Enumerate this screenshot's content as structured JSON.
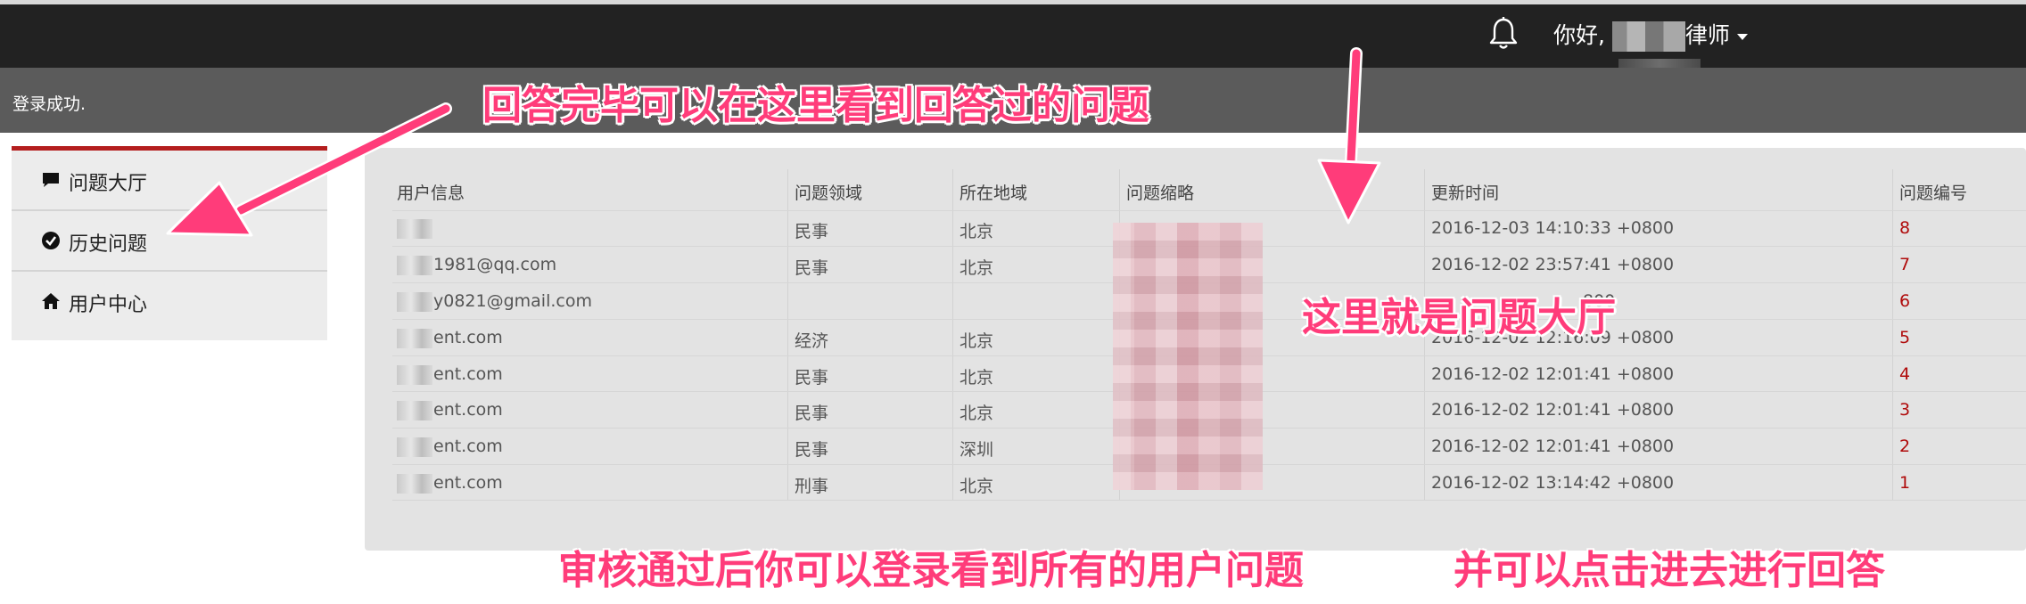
{
  "header": {
    "greeting_prefix": "你好,",
    "greeting_suffix": "律师"
  },
  "flash": {
    "message": "登录成功."
  },
  "sidebar": {
    "items": [
      {
        "label": "问题大厅",
        "icon": "comment-icon"
      },
      {
        "label": "历史问题",
        "icon": "check-circle-icon"
      },
      {
        "label": "用户中心",
        "icon": "home-icon"
      }
    ]
  },
  "table": {
    "columns": [
      "用户信息",
      "问题领域",
      "所在地域",
      "问题缩略",
      "更新时间",
      "问题编号"
    ],
    "rows": [
      {
        "user": "",
        "field": "民事",
        "region": "北京",
        "time": "2016-12-03 14:10:33 +0800",
        "id": "8"
      },
      {
        "user": "1981@qq.com",
        "field": "民事",
        "region": "北京",
        "time": "2016-12-02 23:57:41 +0800",
        "id": "7"
      },
      {
        "user": "y0821@gmail.com",
        "field": "",
        "region": "",
        "time": "",
        "id": "6"
      },
      {
        "user": "ent.com",
        "field": "经济",
        "region": "北京",
        "time": "2016-12-02 12:16:09 +0800",
        "id": "5"
      },
      {
        "user": "ent.com",
        "field": "民事",
        "region": "北京",
        "time": "2016-12-02 12:01:41 +0800",
        "id": "4"
      },
      {
        "user": "ent.com",
        "field": "民事",
        "region": "北京",
        "time": "2016-12-02 12:01:41 +0800",
        "id": "3"
      },
      {
        "user": "ent.com",
        "field": "民事",
        "region": "深圳",
        "time": "2016-12-02 12:01:41 +0800",
        "id": "2"
      },
      {
        "user": "ent.com",
        "field": "刑事",
        "region": "北京",
        "time": "2016-12-02 13:14:42 +0800",
        "id": "1"
      }
    ],
    "partial_time_row3": "800"
  },
  "annotations": {
    "top": "回答完毕可以在这里看到回答过的问题",
    "middle": "这里就是问题大厅",
    "bottom_left": "审核通过后你可以登录看到所有的用户问题",
    "bottom_right": "并可以点击进去进行回答"
  },
  "colors": {
    "accent": "#b41e1e",
    "annotation": "#ff3c7a",
    "topbar": "#222222",
    "flash": "#5b5b5b"
  }
}
